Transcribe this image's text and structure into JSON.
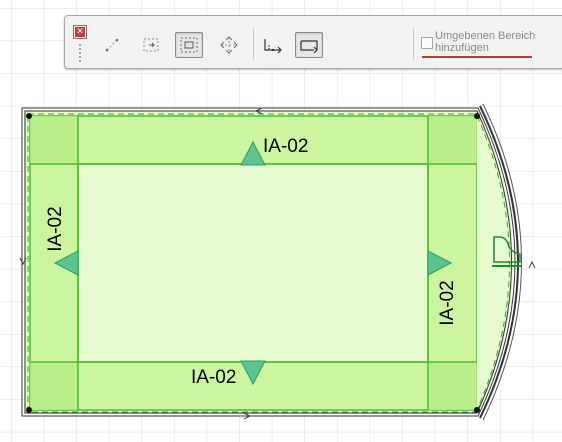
{
  "toolbar": {
    "checkbox_label": "Umgebenen Bereich hinzufügen",
    "checkbox_checked": false,
    "buttons": [
      {
        "name": "scale-points-icon",
        "active": false
      },
      {
        "name": "offset-edge-icon",
        "active": false
      },
      {
        "name": "offset-all-edges-icon",
        "active": true
      },
      {
        "name": "move-node-icon",
        "active": false
      },
      {
        "name": "draft-line-icon",
        "active": false
      },
      {
        "name": "zone-boundary-icon",
        "active": true
      }
    ]
  },
  "zone_labels": {
    "top": "IA-02",
    "left": "IA-02",
    "right": "IA-02",
    "bottom": "IA-02"
  },
  "colors": {
    "grid": "#dcdcdc",
    "zone_fill": "#ccf5a0",
    "zone_edge": "#4cbb2e",
    "marker": "#4fbf88",
    "wall_line": "#333333",
    "accent_underline": "#c0392b"
  }
}
